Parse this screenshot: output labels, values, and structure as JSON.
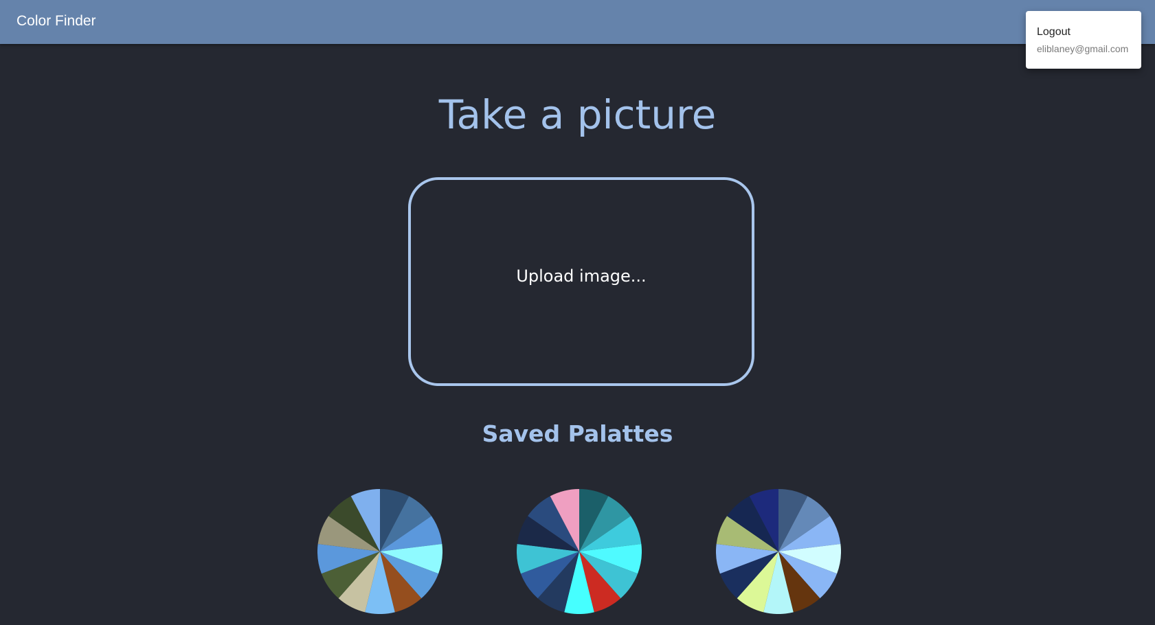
{
  "appbar": {
    "title": "Color Finder"
  },
  "user_menu": {
    "logout_label": "Logout",
    "email": "eliblaney@gmail.com"
  },
  "main": {
    "heading": "Take a picture",
    "upload_label": "Upload image...",
    "saved_heading": "Saved Palattes"
  },
  "colors": {
    "appbar": "#6583ab",
    "background": "#252831",
    "accent_text": "#a3c2eb",
    "upload_border": "#a9c6ec"
  },
  "palettes": [
    {
      "colors": [
        "#2e4e72",
        "#45729f",
        "#5b98dc",
        "#8ffaff",
        "#5c9ddd",
        "#954e1e",
        "#7cbff5",
        "#c7c2a2",
        "#4c5f36",
        "#5b98dc",
        "#9a977c",
        "#3b4a2b",
        "#7fb0ee"
      ]
    },
    {
      "colors": [
        "#1b5f69",
        "#2f96a3",
        "#3ecbdd",
        "#4ffaff",
        "#3ec3d4",
        "#cc2b22",
        "#46ffff",
        "#233a5f",
        "#305b9d",
        "#3ec3d4",
        "#1b2948",
        "#2a4b7e",
        "#ef9fc1"
      ]
    },
    {
      "colors": [
        "#3e5a80",
        "#6489b8",
        "#8ab6f5",
        "#d1fdff",
        "#8ab6f5",
        "#65350e",
        "#b3f6f9",
        "#dcf897",
        "#1a2f5e",
        "#8ab6f5",
        "#a8bb74",
        "#162752",
        "#1d2a7c"
      ]
    }
  ]
}
